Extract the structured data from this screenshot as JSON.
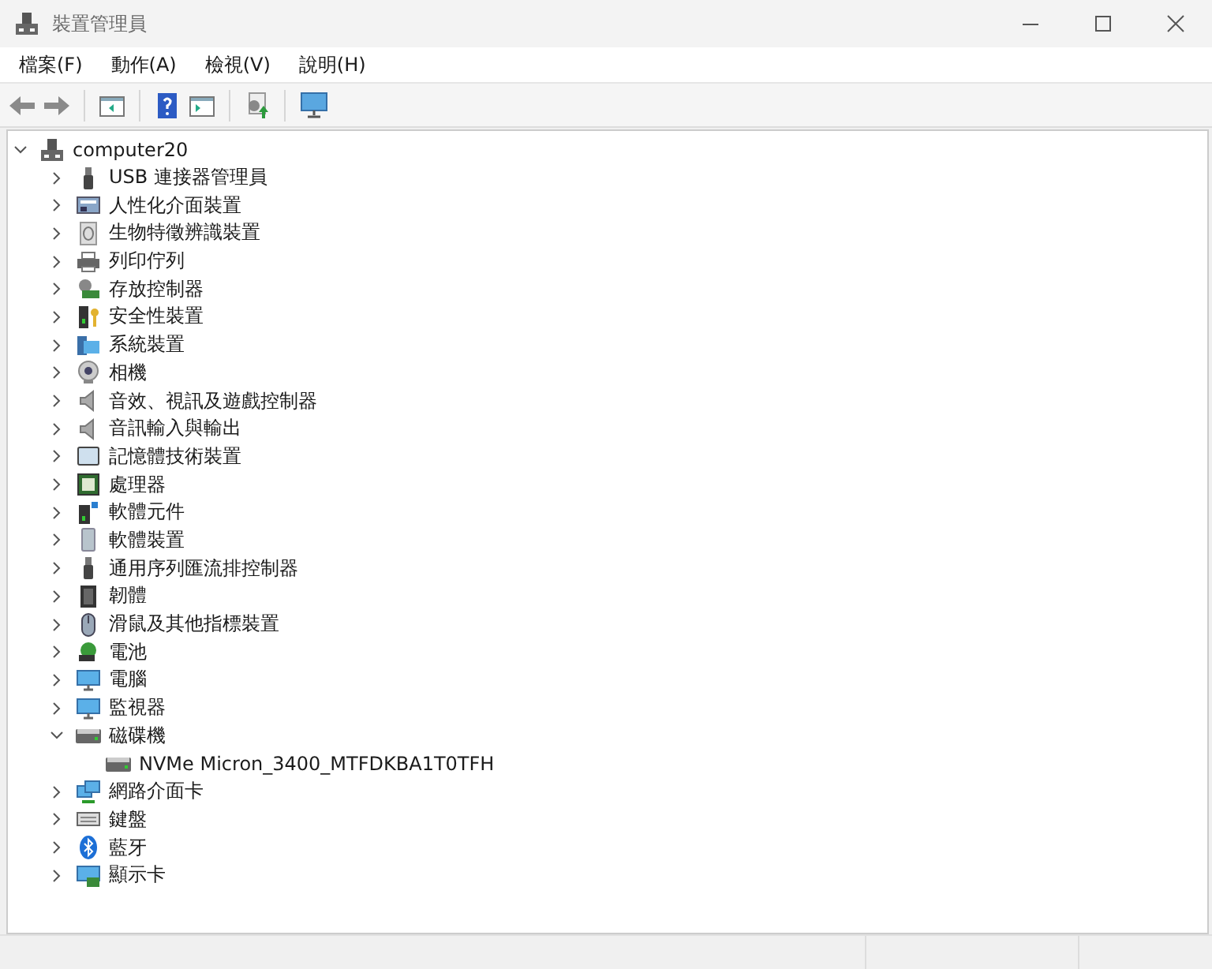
{
  "window": {
    "title": "裝置管理員"
  },
  "menu": [
    "檔案(F)",
    "動作(A)",
    "檢視(V)",
    "說明(H)"
  ],
  "tree": {
    "label": "computer20",
    "expanded": true,
    "children": [
      {
        "label": "USB 連接器管理員",
        "expanded": false
      },
      {
        "label": "人性化介面裝置",
        "expanded": false
      },
      {
        "label": "生物特徵辨識裝置",
        "expanded": false
      },
      {
        "label": "列印佇列",
        "expanded": false
      },
      {
        "label": "存放控制器",
        "expanded": false
      },
      {
        "label": "安全性裝置",
        "expanded": false
      },
      {
        "label": "系統裝置",
        "expanded": false
      },
      {
        "label": "相機",
        "expanded": false
      },
      {
        "label": "音效、視訊及遊戲控制器",
        "expanded": false
      },
      {
        "label": "音訊輸入與輸出",
        "expanded": false
      },
      {
        "label": "記憶體技術裝置",
        "expanded": false
      },
      {
        "label": "處理器",
        "expanded": false
      },
      {
        "label": "軟體元件",
        "expanded": false
      },
      {
        "label": "軟體裝置",
        "expanded": false
      },
      {
        "label": "通用序列匯流排控制器",
        "expanded": false
      },
      {
        "label": "韌體",
        "expanded": false
      },
      {
        "label": "滑鼠及其他指標裝置",
        "expanded": false
      },
      {
        "label": "電池",
        "expanded": false
      },
      {
        "label": "電腦",
        "expanded": false
      },
      {
        "label": "監視器",
        "expanded": false
      },
      {
        "label": "磁碟機",
        "expanded": true,
        "children": [
          {
            "label": "NVMe Micron_3400_MTFDKBA1T0TFH"
          }
        ]
      },
      {
        "label": "網路介面卡",
        "expanded": false
      },
      {
        "label": "鍵盤",
        "expanded": false
      },
      {
        "label": "藍牙",
        "expanded": false
      },
      {
        "label": "顯示卡",
        "expanded": false
      }
    ]
  }
}
